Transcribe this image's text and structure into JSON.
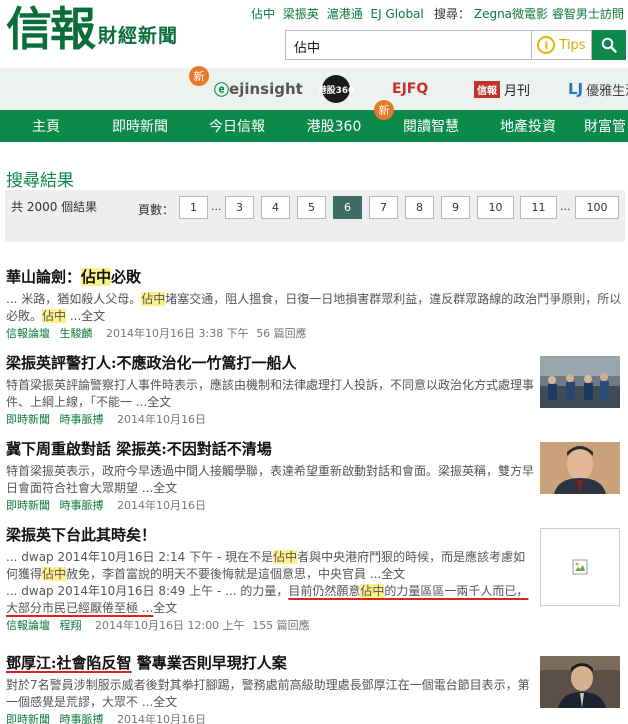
{
  "header": {
    "logo_main": "信報",
    "logo_sub": "財經新聞",
    "hot_links": [
      "佔中",
      "梁振英",
      "滬港通",
      "EJ Global"
    ],
    "search_side_label": "搜尋：",
    "search_side_links": "Zegna微電影 睿智男士訪問",
    "search_value": "佔中",
    "tips_label": "Tips",
    "tips_icon": "i"
  },
  "brands": {
    "new_badge": "新",
    "ejinsight": "ejinsight",
    "gangu": "港股360",
    "efq": "EJFQ",
    "monthly_tag": "信報",
    "monthly": "月刊",
    "lj_mark": "LJ",
    "lj": "優雅生活"
  },
  "nav": {
    "items": [
      "主頁",
      "即時新聞",
      "今日信報",
      "港股360",
      "閱讀智慧",
      "地產投資",
      "財富管"
    ]
  },
  "results": {
    "title": "搜尋結果",
    "total": "共 2000 個結果",
    "pages_label": "頁數：",
    "pages": [
      "1",
      "3",
      "4",
      "5",
      "6",
      "7",
      "8",
      "9",
      "10",
      "11",
      "100"
    ],
    "current_page": "6",
    "ellipsis": "..."
  },
  "articles": [
    {
      "title_prefix": "華山論劍：",
      "title_hl": "佔中",
      "title_suffix": "必敗",
      "snippet": [
        {
          "t": "... 米路，猶如殺人父母。"
        },
        {
          "t": "佔中",
          "hl": true
        },
        {
          "t": "堵塞交通，阻人搵食，日復一日地損害群眾利益，違反群眾路線的政治鬥爭原則，所以必敗。"
        },
        {
          "t": "佔中",
          "hl": true
        },
        {
          "t": " ...全文"
        }
      ],
      "meta_section": "信報論壇",
      "meta_author": "生駿麟",
      "meta_date": "2014年10月16日 3:38 下午",
      "meta_replies": "56 篇回應"
    },
    {
      "title": "梁振英評警打人:不應政治化一竹篙打一船人",
      "snippet": "特首梁振英評論警察打人事件時表示，應該由機制和法律處理打人投訴，不同意以政治化方式處理事件、上綱上線，「不能一 ...全文",
      "meta_section": "即時新聞",
      "meta_sub": "時事脈搏",
      "meta_date": "2014年10月16日"
    },
    {
      "title": "冀下周重啟對話 梁振英:不因對話不清場",
      "snippet": "特首梁振英表示，政府今早透過中間人接觸學聯，表達希望重新啟動對話和會面。梁振英稱，雙方早日會面符合社會大眾期望 ...全文",
      "meta_section": "即時新聞",
      "meta_sub": "時事脈搏",
      "meta_date": "2014年10月16日"
    },
    {
      "title": "梁振英下台此其時矣！",
      "snippet_line1": [
        {
          "t": "... dwap 2014年10月16日 2:14 下午 - 現在不是"
        },
        {
          "t": "佔中",
          "hl": true
        },
        {
          "t": "者與中央港府鬥狠的時候，而是應該考慮如何獲得"
        },
        {
          "t": "佔中",
          "hl": true
        },
        {
          "t": "赦免，李首富說的明天不要後悔就是這個意思，中央官員 ...全文"
        }
      ],
      "snippet_line2": [
        {
          "t": "... dwap 2014年10月16日 8:49 上午 - ... 的力量，"
        },
        {
          "t": "目前仍然願意",
          "ul": true
        },
        {
          "t": "佔中",
          "hl": true,
          "ul": true
        },
        {
          "t": "的力量區區一兩千人而已，大部分市民已經厭倦至極 ...",
          "ul": true
        },
        {
          "t": "全文"
        }
      ],
      "meta_section": "信報論壇",
      "meta_author": "程翔",
      "meta_date": "2014年10月16日 12:00 上午",
      "meta_replies": "155 篇回應"
    },
    {
      "title_ul": "鄧厚江:社會陷反智",
      "title_rest": " 警專業否則早現打人案",
      "snippet": "對於7名警員涉制服示威者後對其拳打腳踢，警務處前高級助理處長鄧厚江在一個電台節目表示，第一個感覺是荒謬，大眾不 ...全文",
      "meta_section": "即時新聞",
      "meta_sub": "時事脈搏",
      "meta_date": "2014年10月16日"
    }
  ],
  "colors": {
    "brand_green": "#0b8a4a",
    "highlight": "#fdf28a",
    "current_page": "#3e6e63",
    "annotation_red": "#e02020"
  }
}
